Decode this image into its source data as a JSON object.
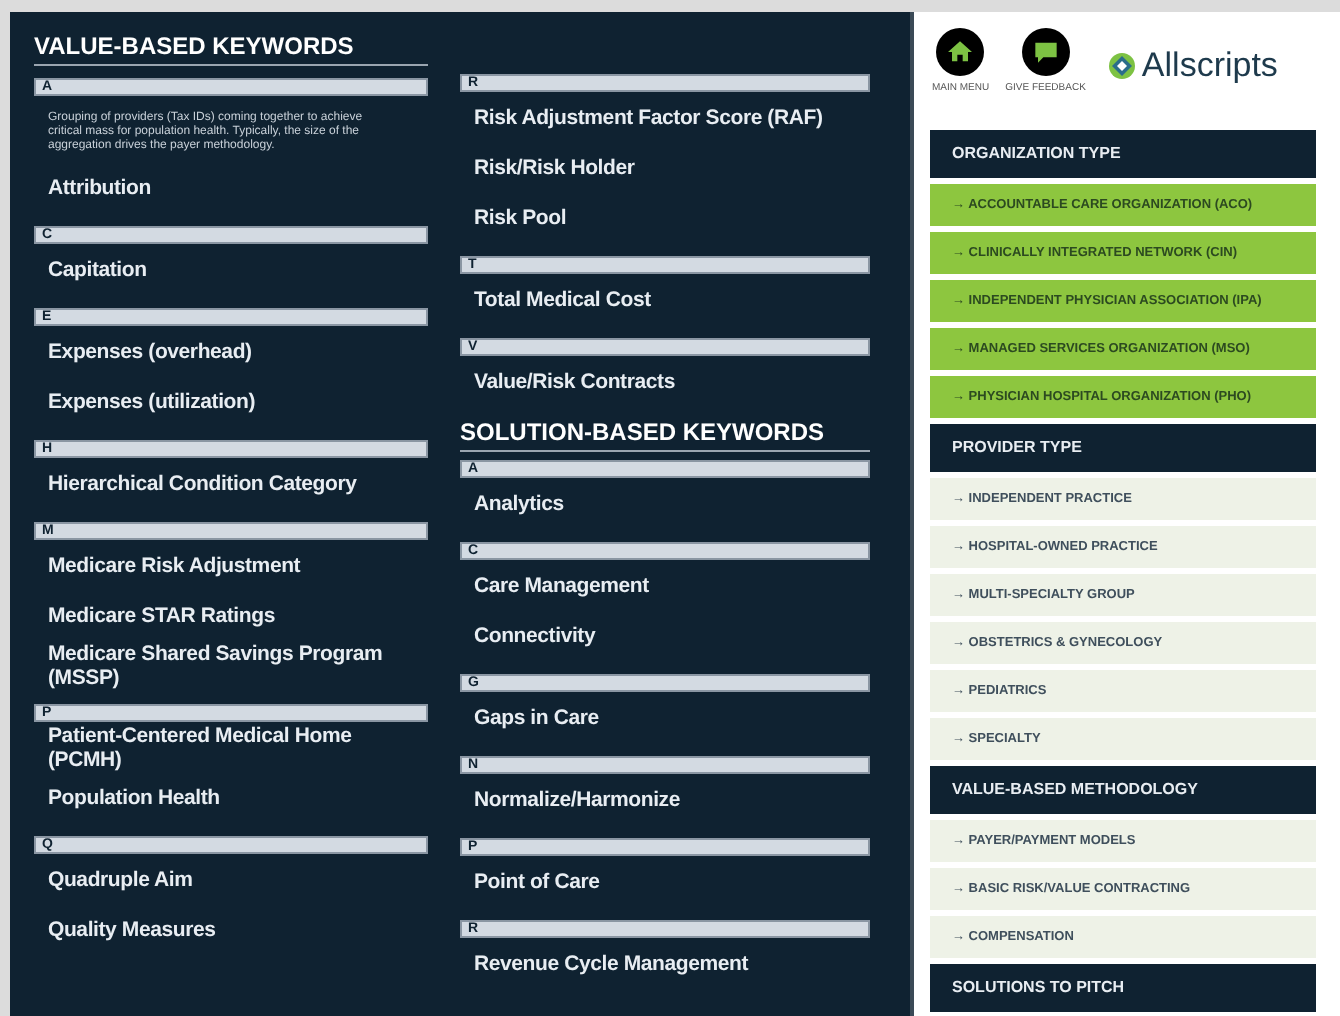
{
  "left_column": {
    "heading": "VALUE-BASED KEYWORDS",
    "groups": [
      {
        "letter": "A",
        "description": "Grouping of providers (Tax IDs) coming together to achieve critical mass for population health. Typically, the size of the aggregation drives the payer methodology.",
        "terms": [
          "Attribution"
        ]
      },
      {
        "letter": "C",
        "terms": [
          "Capitation"
        ]
      },
      {
        "letter": "E",
        "terms": [
          "Expenses (overhead)",
          "Expenses (utilization)"
        ]
      },
      {
        "letter": "H",
        "terms": [
          "Hierarchical Condition Category"
        ]
      },
      {
        "letter": "M",
        "terms": [
          "Medicare Risk Adjustment",
          "Medicare STAR Ratings",
          "Medicare Shared Savings Program (MSSP)"
        ]
      },
      {
        "letter": "P",
        "terms": [
          "Patient-Centered Medical Home (PCMH)",
          "Population Health"
        ]
      },
      {
        "letter": "Q",
        "terms": [
          "Quadruple Aim",
          "Quality Measures"
        ]
      }
    ]
  },
  "middle_column": {
    "groups": [
      {
        "letter": "R",
        "terms": [
          "Risk Adjustment Factor Score (RAF)",
          "Risk/Risk Holder",
          "Risk Pool"
        ]
      },
      {
        "letter": "T",
        "terms": [
          "Total Medical Cost"
        ]
      },
      {
        "letter": "V",
        "terms": [
          "Value/Risk Contracts"
        ]
      }
    ],
    "heading": "SOLUTION-BASED KEYWORDS",
    "solution_groups": [
      {
        "letter": "A",
        "terms": [
          "Analytics"
        ]
      },
      {
        "letter": "C",
        "terms": [
          "Care Management",
          "Connectivity"
        ]
      },
      {
        "letter": "G",
        "terms": [
          "Gaps in Care"
        ]
      },
      {
        "letter": "N",
        "terms": [
          "Normalize/Harmonize"
        ]
      },
      {
        "letter": "P",
        "terms": [
          "Point of Care"
        ]
      },
      {
        "letter": "R",
        "terms": [
          "Revenue Cycle Management"
        ]
      }
    ]
  },
  "nav_buttons": [
    {
      "kind": "home",
      "label": "MAIN MENU"
    },
    {
      "kind": "feedback",
      "label": "GIVE FEEDBACK"
    }
  ],
  "logo": {
    "text": "Allscripts"
  },
  "sections": [
    {
      "title": "ORGANIZATION TYPE",
      "kind": "primary",
      "items": [
        "→ ACCOUNTABLE CARE ORGANIZATION (ACO)",
        "→ CLINICALLY INTEGRATED NETWORK (CIN)",
        "→ INDEPENDENT PHYSICIAN ASSOCIATION (IPA)",
        "→ MANAGED SERVICES ORGANIZATION (MSO)",
        "→ PHYSICIAN HOSPITAL ORGANIZATION (PHO)"
      ]
    },
    {
      "title": "PROVIDER TYPE",
      "kind": "secondary",
      "items": [
        "→ INDEPENDENT PRACTICE",
        "→ HOSPITAL-OWNED PRACTICE",
        "→ MULTI-SPECIALTY GROUP",
        "→ OBSTETRICS & GYNECOLOGY",
        "→ PEDIATRICS",
        "→ SPECIALTY"
      ]
    },
    {
      "title": "VALUE-BASED METHODOLOGY",
      "kind": "secondary",
      "items": [
        "→ PAYER/PAYMENT MODELS",
        "→ BASIC RISK/VALUE CONTRACTING",
        "→ COMPENSATION"
      ]
    },
    {
      "title": "SOLUTIONS TO PITCH"
    }
  ]
}
